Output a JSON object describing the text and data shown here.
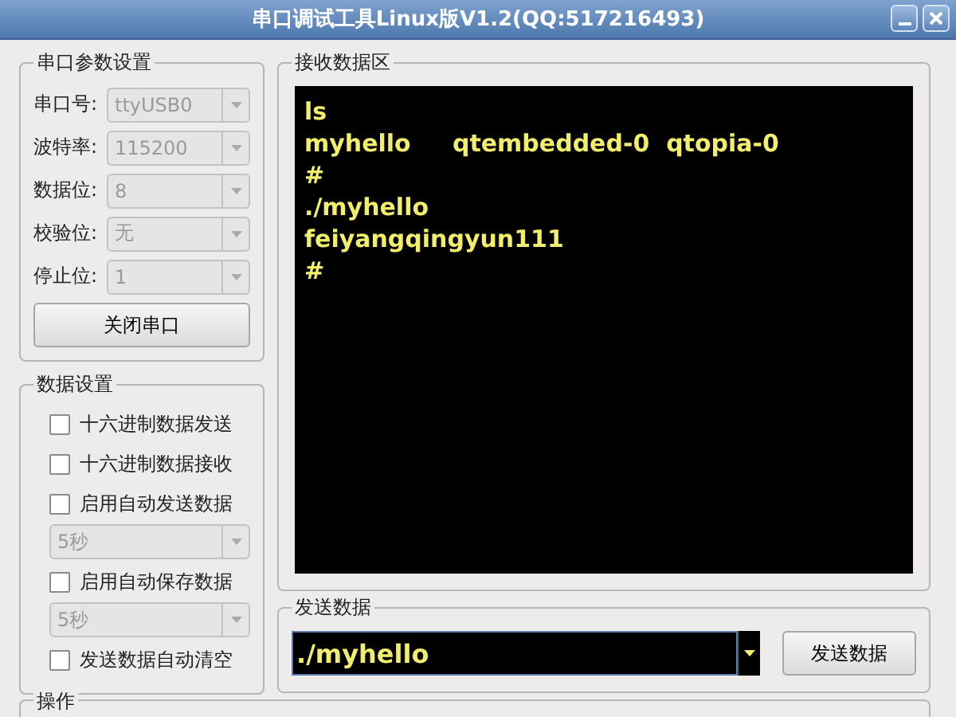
{
  "window": {
    "title": "串口调试工具Linux版V1.2(QQ:517216493)"
  },
  "serial_settings": {
    "title": "串口参数设置",
    "fields": [
      {
        "label": "串口号:",
        "value": "ttyUSB0",
        "disabled": true
      },
      {
        "label": "波特率:",
        "value": "115200",
        "disabled": true
      },
      {
        "label": "数据位:",
        "value": "8",
        "disabled": true
      },
      {
        "label": "校验位:",
        "value": "无",
        "disabled": true
      },
      {
        "label": "停止位:",
        "value": "1",
        "disabled": true
      }
    ],
    "button": "关闭串口"
  },
  "data_settings": {
    "title": "数据设置",
    "items": [
      {
        "kind": "checkbox",
        "label": "十六进制数据发送",
        "checked": false
      },
      {
        "kind": "checkbox",
        "label": "十六进制数据接收",
        "checked": false
      },
      {
        "kind": "checkbox",
        "label": "启用自动发送数据",
        "checked": false
      },
      {
        "kind": "combo",
        "value": "5秒",
        "disabled": true
      },
      {
        "kind": "checkbox",
        "label": "启用自动保存数据",
        "checked": false
      },
      {
        "kind": "combo",
        "value": "5秒",
        "disabled": true
      },
      {
        "kind": "checkbox",
        "label": "发送数据自动清空",
        "checked": false
      }
    ]
  },
  "receive": {
    "title": "接收数据区",
    "lines": [
      "ls",
      "myhello     qtembedded-0  qtopia-0",
      "#",
      "./myhello",
      "feiyangqingyun111",
      "#"
    ]
  },
  "send": {
    "title": "发送数据",
    "value": "./myhello",
    "button": "发送数据"
  },
  "operations": {
    "title": "操作"
  }
}
